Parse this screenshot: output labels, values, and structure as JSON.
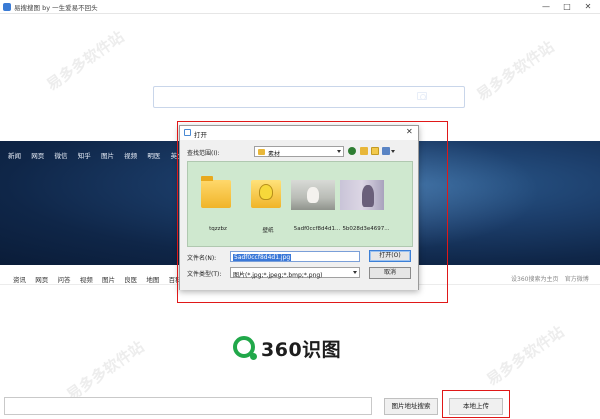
{
  "window": {
    "title": "易搜搜图 by 一生爱易不回头",
    "minimize_glyph": "—",
    "maximize_glyph": "□",
    "close_glyph": "✕"
  },
  "banner": {
    "nav_items": [
      "新闻",
      "网页",
      "微信",
      "知乎",
      "图片",
      "视频",
      "明医",
      "英文"
    ]
  },
  "sub_nav": {
    "items": [
      "资讯",
      "网页",
      "问答",
      "视频",
      "图片",
      "良医",
      "地图",
      "百科"
    ],
    "right_links": [
      "设360搜索为主页",
      "官方微博"
    ]
  },
  "logo": {
    "text": "360识图",
    "color": "#21a84a"
  },
  "bottom_bar": {
    "url_input_value": "",
    "image_url_search_label": "图片地址搜索",
    "local_upload_label": "本地上传"
  },
  "watermark": {
    "text": "易多多软件站"
  },
  "dialog": {
    "title": "打开",
    "close_glyph": "✕",
    "look_in_label": "查找范围(I):",
    "look_in_value": "素材",
    "files": [
      {
        "name": "tqzzbz",
        "kind": "folder"
      },
      {
        "name": "壁纸",
        "kind": "folder"
      },
      {
        "name": "5adf0ccf8d4d1...",
        "kind": "image"
      },
      {
        "name": "5b028d3e4697...",
        "kind": "image"
      }
    ],
    "file_name_label": "文件名(N):",
    "file_name_value": "5adf0ccf8d4d1.jpg",
    "file_type_label": "文件类型(T):",
    "file_type_value": "图片(*.jpg;*.jpeg;*.bmp;*.png)",
    "open_button": "打开(O)",
    "cancel_button": "取消"
  },
  "annotation_color": "#e01818"
}
